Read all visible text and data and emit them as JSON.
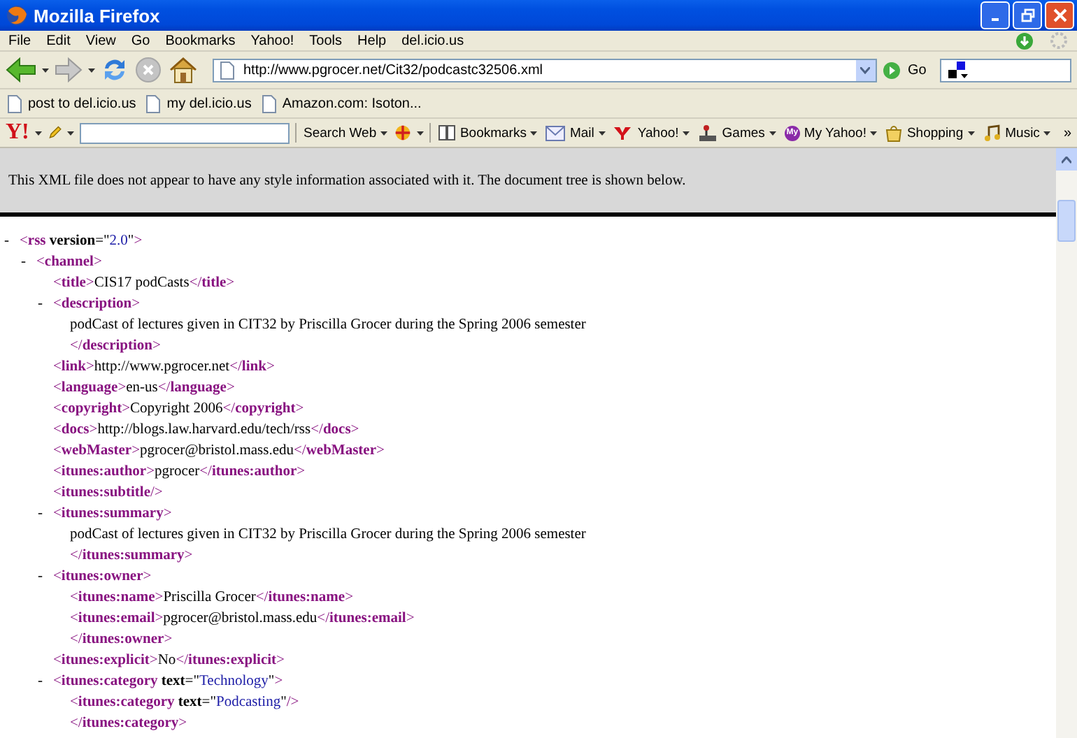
{
  "window": {
    "title": "Mozilla Firefox"
  },
  "menu": [
    "File",
    "Edit",
    "View",
    "Go",
    "Bookmarks",
    "Yahoo!",
    "Tools",
    "Help",
    "del.icio.us"
  ],
  "address": {
    "value": "http://www.pgrocer.net/Cit32/podcastc32506.xml"
  },
  "go_label": "Go",
  "bookmarks": [
    "post to del.icio.us",
    "my del.icio.us",
    "Amazon.com: Isoton..."
  ],
  "yahoo_toolbar": {
    "logo": "Y!",
    "search_label": "Search Web",
    "items": [
      {
        "kind": "bookmarks",
        "label": "Bookmarks"
      },
      {
        "kind": "mail",
        "label": "Mail"
      },
      {
        "kind": "yahoo",
        "label": "Yahoo!"
      },
      {
        "kind": "games",
        "label": "Games"
      },
      {
        "kind": "myyahoo",
        "label": "My Yahoo!",
        "icon_text": "My"
      },
      {
        "kind": "shopping",
        "label": "Shopping"
      },
      {
        "kind": "music",
        "label": "Music"
      }
    ],
    "more": "»"
  },
  "info": "This XML file does not appear to have any style information associated with it. The document tree is shown below.",
  "tree": [
    {
      "toggle": "-",
      "line": [
        {
          "kind": "bracket",
          "text": "<"
        },
        {
          "kind": "tag",
          "text": "rss"
        },
        {
          "kind": "attr",
          "text": " version"
        },
        {
          "kind": "text",
          "text": "=\""
        },
        {
          "kind": "value",
          "text": "2.0"
        },
        {
          "kind": "text",
          "text": "\""
        },
        {
          "kind": "bracket",
          "text": ">"
        }
      ],
      "children": [
        {
          "toggle": "-",
          "line": [
            {
              "kind": "bracket",
              "text": "<"
            },
            {
              "kind": "tag",
              "text": "channel"
            },
            {
              "kind": "bracket",
              "text": ">"
            }
          ],
          "children": [
            {
              "line": [
                {
                  "kind": "bracket",
                  "text": "<"
                },
                {
                  "kind": "tag",
                  "text": "title"
                },
                {
                  "kind": "bracket",
                  "text": ">"
                },
                {
                  "kind": "text",
                  "text": "CIS17 podCasts"
                },
                {
                  "kind": "bracket",
                  "text": "</"
                },
                {
                  "kind": "tag",
                  "text": "title"
                },
                {
                  "kind": "bracket",
                  "text": ">"
                }
              ]
            },
            {
              "toggle": "-",
              "line": [
                {
                  "kind": "bracket",
                  "text": "<"
                },
                {
                  "kind": "tag",
                  "text": "description"
                },
                {
                  "kind": "bracket",
                  "text": ">"
                }
              ],
              "children": [
                {
                  "line": [
                    {
                      "kind": "text",
                      "text": "podCast of lectures given in CIT32 by Priscilla Grocer during the Spring 2006 semester"
                    }
                  ]
                }
              ],
              "close": [
                {
                  "kind": "bracket",
                  "text": "</"
                },
                {
                  "kind": "tag",
                  "text": "description"
                },
                {
                  "kind": "bracket",
                  "text": ">"
                }
              ]
            },
            {
              "line": [
                {
                  "kind": "bracket",
                  "text": "<"
                },
                {
                  "kind": "tag",
                  "text": "link"
                },
                {
                  "kind": "bracket",
                  "text": ">"
                },
                {
                  "kind": "text",
                  "text": "http://www.pgrocer.net"
                },
                {
                  "kind": "bracket",
                  "text": "</"
                },
                {
                  "kind": "tag",
                  "text": "link"
                },
                {
                  "kind": "bracket",
                  "text": ">"
                }
              ]
            },
            {
              "line": [
                {
                  "kind": "bracket",
                  "text": "<"
                },
                {
                  "kind": "tag",
                  "text": "language"
                },
                {
                  "kind": "bracket",
                  "text": ">"
                },
                {
                  "kind": "text",
                  "text": "en-us"
                },
                {
                  "kind": "bracket",
                  "text": "</"
                },
                {
                  "kind": "tag",
                  "text": "language"
                },
                {
                  "kind": "bracket",
                  "text": ">"
                }
              ]
            },
            {
              "line": [
                {
                  "kind": "bracket",
                  "text": "<"
                },
                {
                  "kind": "tag",
                  "text": "copyright"
                },
                {
                  "kind": "bracket",
                  "text": ">"
                },
                {
                  "kind": "text",
                  "text": "Copyright 2006"
                },
                {
                  "kind": "bracket",
                  "text": "</"
                },
                {
                  "kind": "tag",
                  "text": "copyright"
                },
                {
                  "kind": "bracket",
                  "text": ">"
                }
              ]
            },
            {
              "line": [
                {
                  "kind": "bracket",
                  "text": "<"
                },
                {
                  "kind": "tag",
                  "text": "docs"
                },
                {
                  "kind": "bracket",
                  "text": ">"
                },
                {
                  "kind": "text",
                  "text": "http://blogs.law.harvard.edu/tech/rss"
                },
                {
                  "kind": "bracket",
                  "text": "</"
                },
                {
                  "kind": "tag",
                  "text": "docs"
                },
                {
                  "kind": "bracket",
                  "text": ">"
                }
              ]
            },
            {
              "line": [
                {
                  "kind": "bracket",
                  "text": "<"
                },
                {
                  "kind": "tag",
                  "text": "webMaster"
                },
                {
                  "kind": "bracket",
                  "text": ">"
                },
                {
                  "kind": "text",
                  "text": "pgrocer@bristol.mass.edu"
                },
                {
                  "kind": "bracket",
                  "text": "</"
                },
                {
                  "kind": "tag",
                  "text": "webMaster"
                },
                {
                  "kind": "bracket",
                  "text": ">"
                }
              ]
            },
            {
              "line": [
                {
                  "kind": "bracket",
                  "text": "<"
                },
                {
                  "kind": "tag",
                  "text": "itunes:author"
                },
                {
                  "kind": "bracket",
                  "text": ">"
                },
                {
                  "kind": "text",
                  "text": "pgrocer"
                },
                {
                  "kind": "bracket",
                  "text": "</"
                },
                {
                  "kind": "tag",
                  "text": "itunes:author"
                },
                {
                  "kind": "bracket",
                  "text": ">"
                }
              ]
            },
            {
              "line": [
                {
                  "kind": "bracket",
                  "text": "<"
                },
                {
                  "kind": "tag",
                  "text": "itunes:subtitle"
                },
                {
                  "kind": "bracket",
                  "text": "/>"
                }
              ]
            },
            {
              "toggle": "-",
              "line": [
                {
                  "kind": "bracket",
                  "text": "<"
                },
                {
                  "kind": "tag",
                  "text": "itunes:summary"
                },
                {
                  "kind": "bracket",
                  "text": ">"
                }
              ],
              "children": [
                {
                  "line": [
                    {
                      "kind": "text",
                      "text": "podCast of lectures given in CIT32 by Priscilla Grocer during the Spring 2006 semester"
                    }
                  ]
                }
              ],
              "close": [
                {
                  "kind": "bracket",
                  "text": "</"
                },
                {
                  "kind": "tag",
                  "text": "itunes:summary"
                },
                {
                  "kind": "bracket",
                  "text": ">"
                }
              ]
            },
            {
              "toggle": "-",
              "line": [
                {
                  "kind": "bracket",
                  "text": "<"
                },
                {
                  "kind": "tag",
                  "text": "itunes:owner"
                },
                {
                  "kind": "bracket",
                  "text": ">"
                }
              ],
              "children": [
                {
                  "line": [
                    {
                      "kind": "bracket",
                      "text": "<"
                    },
                    {
                      "kind": "tag",
                      "text": "itunes:name"
                    },
                    {
                      "kind": "bracket",
                      "text": ">"
                    },
                    {
                      "kind": "text",
                      "text": "Priscilla Grocer"
                    },
                    {
                      "kind": "bracket",
                      "text": "</"
                    },
                    {
                      "kind": "tag",
                      "text": "itunes:name"
                    },
                    {
                      "kind": "bracket",
                      "text": ">"
                    }
                  ]
                },
                {
                  "line": [
                    {
                      "kind": "bracket",
                      "text": "<"
                    },
                    {
                      "kind": "tag",
                      "text": "itunes:email"
                    },
                    {
                      "kind": "bracket",
                      "text": ">"
                    },
                    {
                      "kind": "text",
                      "text": "pgrocer@bristol.mass.edu"
                    },
                    {
                      "kind": "bracket",
                      "text": "</"
                    },
                    {
                      "kind": "tag",
                      "text": "itunes:email"
                    },
                    {
                      "kind": "bracket",
                      "text": ">"
                    }
                  ]
                }
              ],
              "close": [
                {
                  "kind": "bracket",
                  "text": "</"
                },
                {
                  "kind": "tag",
                  "text": "itunes:owner"
                },
                {
                  "kind": "bracket",
                  "text": ">"
                }
              ]
            },
            {
              "line": [
                {
                  "kind": "bracket",
                  "text": "<"
                },
                {
                  "kind": "tag",
                  "text": "itunes:explicit"
                },
                {
                  "kind": "bracket",
                  "text": ">"
                },
                {
                  "kind": "text",
                  "text": "No"
                },
                {
                  "kind": "bracket",
                  "text": "</"
                },
                {
                  "kind": "tag",
                  "text": "itunes:explicit"
                },
                {
                  "kind": "bracket",
                  "text": ">"
                }
              ]
            },
            {
              "toggle": "-",
              "line": [
                {
                  "kind": "bracket",
                  "text": "<"
                },
                {
                  "kind": "tag",
                  "text": "itunes:category"
                },
                {
                  "kind": "attr",
                  "text": " text"
                },
                {
                  "kind": "text",
                  "text": "=\""
                },
                {
                  "kind": "value",
                  "text": "Technology"
                },
                {
                  "kind": "text",
                  "text": "\""
                },
                {
                  "kind": "bracket",
                  "text": ">"
                }
              ],
              "children": [
                {
                  "line": [
                    {
                      "kind": "bracket",
                      "text": "<"
                    },
                    {
                      "kind": "tag",
                      "text": "itunes:category"
                    },
                    {
                      "kind": "attr",
                      "text": " text"
                    },
                    {
                      "kind": "text",
                      "text": "=\""
                    },
                    {
                      "kind": "value",
                      "text": "Podcasting"
                    },
                    {
                      "kind": "text",
                      "text": "\""
                    },
                    {
                      "kind": "bracket",
                      "text": "/>"
                    }
                  ]
                }
              ],
              "close": [
                {
                  "kind": "bracket",
                  "text": "</"
                },
                {
                  "kind": "tag",
                  "text": "itunes:category"
                },
                {
                  "kind": "bracket",
                  "text": ">"
                }
              ]
            }
          ]
        }
      ]
    }
  ]
}
